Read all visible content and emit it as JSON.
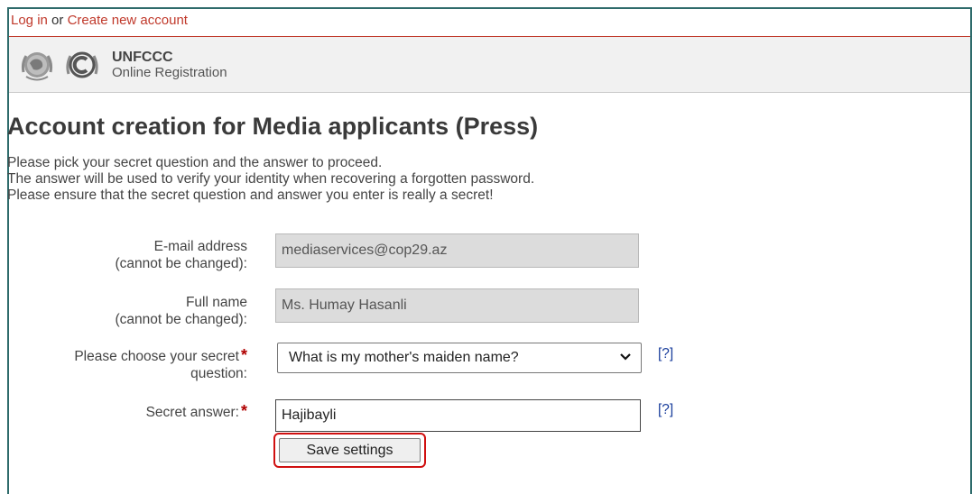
{
  "topbar": {
    "login": "Log in",
    "or": " or ",
    "create": "Create new account"
  },
  "brand": {
    "title": "UNFCCC",
    "subtitle": "Online Registration"
  },
  "page": {
    "title": "Account creation for Media applicants (Press)",
    "intro": [
      "Please pick your secret question and the answer to proceed.",
      "The answer will be used to verify your identity when recovering a forgotten password.",
      "Please ensure that the secret question and answer you enter is really a secret!"
    ]
  },
  "form": {
    "email_label_1": "E-mail address",
    "email_label_2": "(cannot be changed):",
    "email_value": "mediaservices@cop29.az",
    "fullname_label_1": "Full name",
    "fullname_label_2": "(cannot be changed):",
    "fullname_value": "Ms. Humay Hasanli",
    "question_label_1": "Please choose your secret",
    "question_label_2": "question:",
    "question_value": "What is my mother's maiden name?",
    "answer_label": "Secret answer:",
    "answer_value": "Hajibayli",
    "required_mark": "*",
    "help_link": "[?]",
    "save_label": "Save settings"
  },
  "colors": {
    "link": "#c0392b",
    "required": "#b00000",
    "help": "#1a3e9c",
    "highlight": "#d01010"
  },
  "icons": [
    "un-emblem-icon",
    "copyright-c-icon",
    "chevron-down-icon"
  ]
}
